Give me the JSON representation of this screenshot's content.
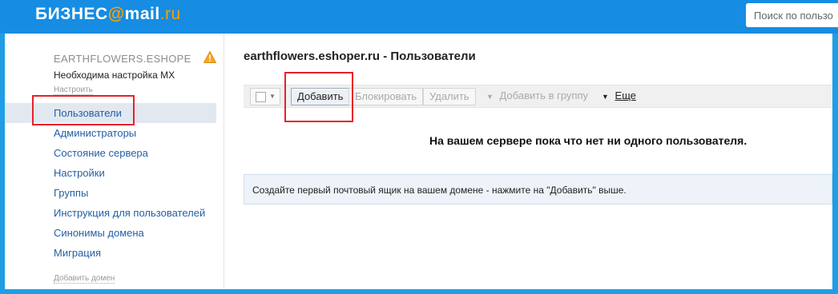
{
  "header": {
    "logo_main": "БИЗНЕС",
    "logo_at": "@",
    "logo_mail": "mail",
    "logo_dot": ".",
    "logo_ru": "ru",
    "search_placeholder": "Поиск по пользо"
  },
  "sidebar": {
    "domain": "EARTHFLOWERS.ESHOPER.RU",
    "mx_notice": "Необходима настройка MX",
    "configure_link": "Настроить",
    "items": [
      {
        "label": "Пользователи",
        "active": true
      },
      {
        "label": "Администраторы"
      },
      {
        "label": "Состояние сервера"
      },
      {
        "label": "Настройки"
      },
      {
        "label": "Группы"
      },
      {
        "label": "Инструкция для пользователей"
      },
      {
        "label": "Синонимы домена"
      },
      {
        "label": "Миграция"
      }
    ],
    "add_domain": "Добавить домен"
  },
  "main": {
    "title": "earthflowers.eshoper.ru - Пользователи",
    "toolbar": {
      "add": "Добавить",
      "block": "Блокировать",
      "delete": "Удалить",
      "add_to_group": "Добавить в группу",
      "more": "Еще"
    },
    "empty_message": "На вашем сервере пока что нет ни одного пользователя.",
    "info_message": "Создайте первый почтовый ящик на вашем домене - нажмите на \"Добавить\" выше."
  },
  "colors": {
    "frame_blue": "#1e9ee6",
    "logo_accent": "#ff9e00",
    "link_blue": "#2360a5",
    "highlight_red": "#e8202a"
  }
}
